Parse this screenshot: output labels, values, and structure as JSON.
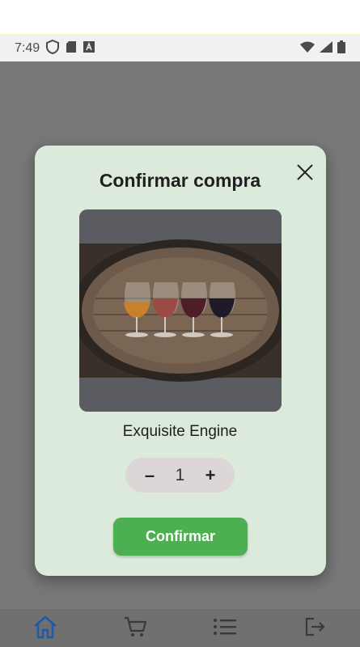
{
  "status_bar": {
    "time": "7:49",
    "icons_left": [
      "shield-icon",
      "sd-card-icon",
      "text-a-icon"
    ],
    "icons_right": [
      "wifi-icon",
      "signal-icon",
      "battery-icon"
    ]
  },
  "modal": {
    "title": "Confirmar compra",
    "close_icon": "close-icon",
    "product_image_alt": "wine glasses on barrel",
    "product_name": "Exquisite Engine",
    "quantity": "1",
    "minus_label": "–",
    "plus_label": "+",
    "confirm_label": "Confirmar"
  },
  "bottom_nav": {
    "items": [
      "home-icon",
      "cart-icon",
      "list-icon",
      "logout-icon"
    ],
    "active_color": "#1e5aa8",
    "inactive_color": "#3a3a3a"
  },
  "colors": {
    "modal_bg": "#dceadb",
    "overlay": "#787878",
    "confirm_button": "#4caf50",
    "stepper_bg": "#ddd6d6"
  }
}
